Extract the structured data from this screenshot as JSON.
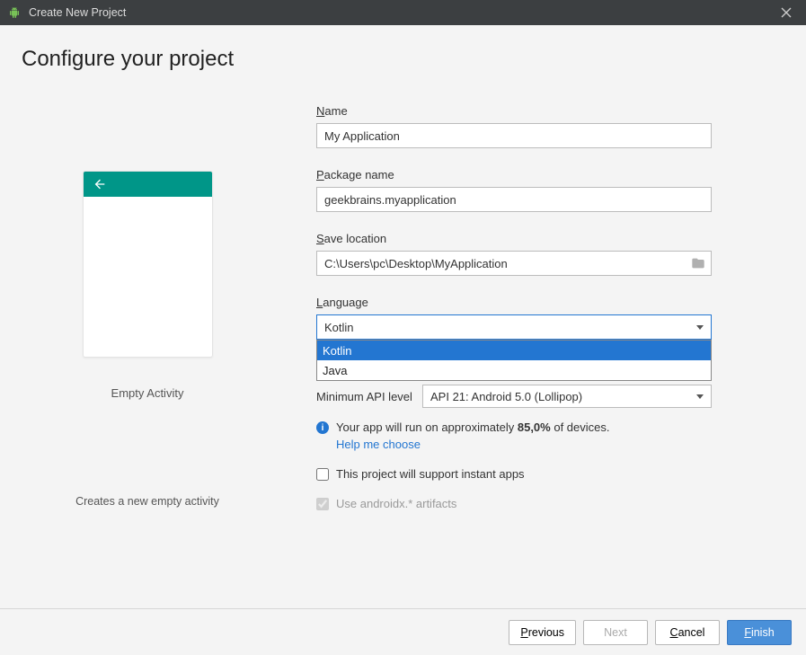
{
  "window": {
    "title": "Create New Project"
  },
  "page": {
    "heading": "Configure your project"
  },
  "preview": {
    "template_name": "Empty Activity",
    "description": "Creates a new empty activity"
  },
  "form": {
    "name": {
      "label": "Name",
      "mnemonic": "N",
      "rest": "ame",
      "value": "My Application"
    },
    "package": {
      "label": "Package name",
      "mnemonic": "P",
      "rest": "ackage name",
      "value": "geekbrains.myapplication"
    },
    "save_location": {
      "label": "Save location",
      "mnemonic": "S",
      "rest": "ave location",
      "value": "C:\\Users\\pc\\Desktop\\MyApplication"
    },
    "language": {
      "label": "Language",
      "mnemonic": "L",
      "rest": "anguage",
      "selected": "Kotlin",
      "options": [
        "Kotlin",
        "Java"
      ]
    },
    "min_api": {
      "label": "Minimum API level",
      "value": "API 21: Android 5.0 (Lollipop)"
    },
    "info": {
      "text_before": "Your app will run on approximately ",
      "percent": "85,0%",
      "text_after": " of devices.",
      "help": "Help me choose"
    },
    "instant_apps": {
      "label": "This project will support instant apps",
      "checked": false
    },
    "androidx": {
      "label": "Use androidx.* artifacts",
      "checked": true,
      "disabled": true
    }
  },
  "footer": {
    "previous": "Previous",
    "previous_m": "P",
    "previous_r": "revious",
    "next": "Next",
    "cancel": "Cancel",
    "cancel_m": "C",
    "cancel_r": "ancel",
    "finish": "Finish",
    "finish_m": "F",
    "finish_r": "inish"
  }
}
